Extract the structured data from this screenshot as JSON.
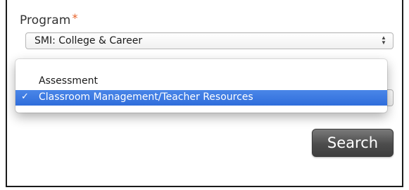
{
  "form": {
    "program_label": "Program",
    "required_marker": "*",
    "program_select": {
      "selected_value": "SMI: College & Career"
    },
    "category_dropdown": {
      "options": [
        {
          "label": "Assessment",
          "selected": false
        },
        {
          "label": "Classroom Management/Teacher Resources",
          "selected": true
        }
      ],
      "check_glyph": "✓"
    },
    "search_label": "Search"
  },
  "icons": {
    "select_arrows": "updown-arrows-icon",
    "check": "checkmark-icon"
  },
  "colors": {
    "required": "#e8632a",
    "highlight": "#3a78e0",
    "button": "#4c4c4c"
  }
}
